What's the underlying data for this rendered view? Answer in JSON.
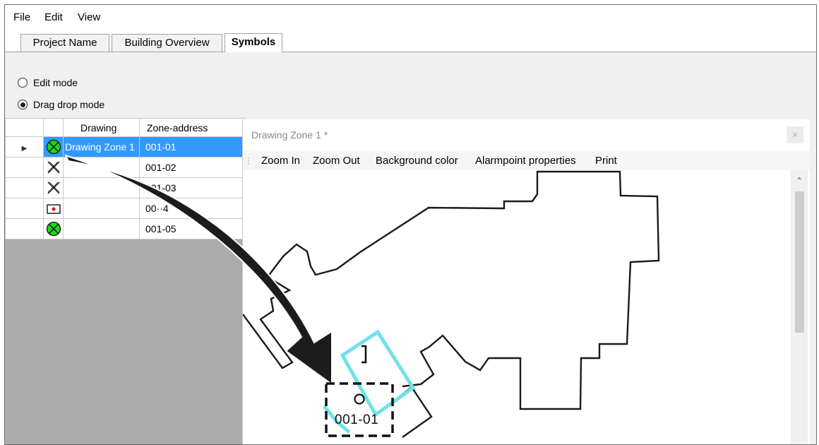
{
  "menu": {
    "file": "File",
    "edit": "Edit",
    "view": "View"
  },
  "tabs": [
    {
      "label": "Project Name",
      "active": false
    },
    {
      "label": "Building Overview",
      "active": false
    },
    {
      "label": "Symbols",
      "active": true
    }
  ],
  "modes": {
    "edit_mode": "Edit mode",
    "drag_drop_mode": "Drag drop mode",
    "selected": "drag_drop_mode"
  },
  "grid": {
    "columns": [
      "Drawing",
      "Zone-address"
    ],
    "rows": [
      {
        "symbol": "green-circle-x-icon",
        "drawing": "Drawing Zone 1",
        "zone": "001-01",
        "selected": true
      },
      {
        "symbol": "x-cross-icon",
        "drawing": "",
        "zone": "001-02",
        "selected": false
      },
      {
        "symbol": "x-cross-icon",
        "drawing": "",
        "zone": "001-03",
        "selected": false
      },
      {
        "symbol": "red-dot-box-icon",
        "drawing": "",
        "zone": "00··4",
        "selected": false
      },
      {
        "symbol": "green-circle-x-icon",
        "drawing": "",
        "zone": "001-05",
        "selected": false
      }
    ]
  },
  "drawing_window": {
    "title": "Drawing Zone 1 *",
    "toolbar": [
      "Zoom In",
      "Zoom Out",
      "Background color",
      "Alarmpoint properties",
      "Print"
    ],
    "placed_zone_label": "001-01"
  },
  "colors": {
    "selection": "#3399ff",
    "zone_outline": "#6fe3e6",
    "symbol_green": "#22d322"
  }
}
